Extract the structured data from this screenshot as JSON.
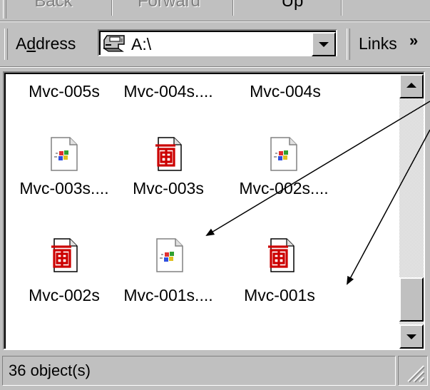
{
  "toolbar": {
    "back_label": "Back",
    "forward_label": "Forward",
    "up_label": "Up"
  },
  "address_bar": {
    "label": "Address",
    "value": "A:\\",
    "links_label": "Links",
    "links_more": "»"
  },
  "files": [
    {
      "name": "Mvc-005s",
      "icon": "jpeg-image-icon"
    },
    {
      "name": "Mvc-004s....",
      "icon": "jpeg-image-icon"
    },
    {
      "name": "Mvc-004s",
      "icon": "jpeg-image-icon"
    },
    {
      "name": "Mvc-003s....",
      "icon": "windows-document-icon"
    },
    {
      "name": "Mvc-003s",
      "icon": "jpeg-image-icon"
    },
    {
      "name": "Mvc-002s....",
      "icon": "windows-document-icon"
    },
    {
      "name": "Mvc-002s",
      "icon": "jpeg-image-icon"
    },
    {
      "name": "Mvc-001s....",
      "icon": "windows-document-icon"
    },
    {
      "name": "Mvc-001s",
      "icon": "jpeg-image-icon"
    }
  ],
  "status": {
    "text": "36 object(s)"
  },
  "colors": {
    "face": "#c0c0c0",
    "shadow": "#808080",
    "highlight": "#ffffff",
    "jpeg_glyph": "#cc0000",
    "annotation_arrow": "#000000"
  }
}
